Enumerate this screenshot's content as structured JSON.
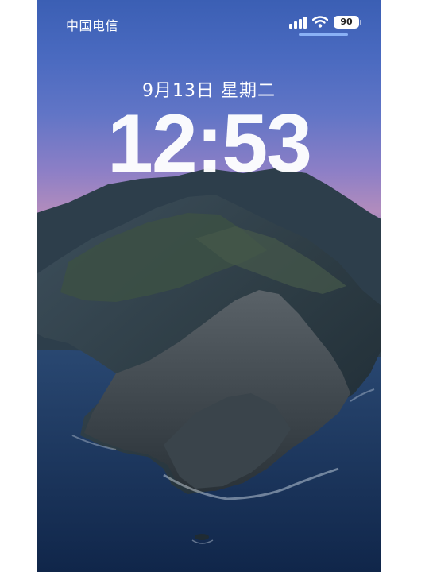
{
  "status_bar": {
    "carrier": "中国电信",
    "battery_level": "90",
    "icons": [
      "signal-icon",
      "wifi-icon",
      "battery-icon"
    ]
  },
  "lock_screen": {
    "date": "9月13日 星期二",
    "time": "12:53"
  },
  "colors": {
    "sky_top": "#3b5fb4",
    "sky_horizon": "#b28cbd",
    "sea": "#142c4e",
    "text": "#ffffff"
  }
}
